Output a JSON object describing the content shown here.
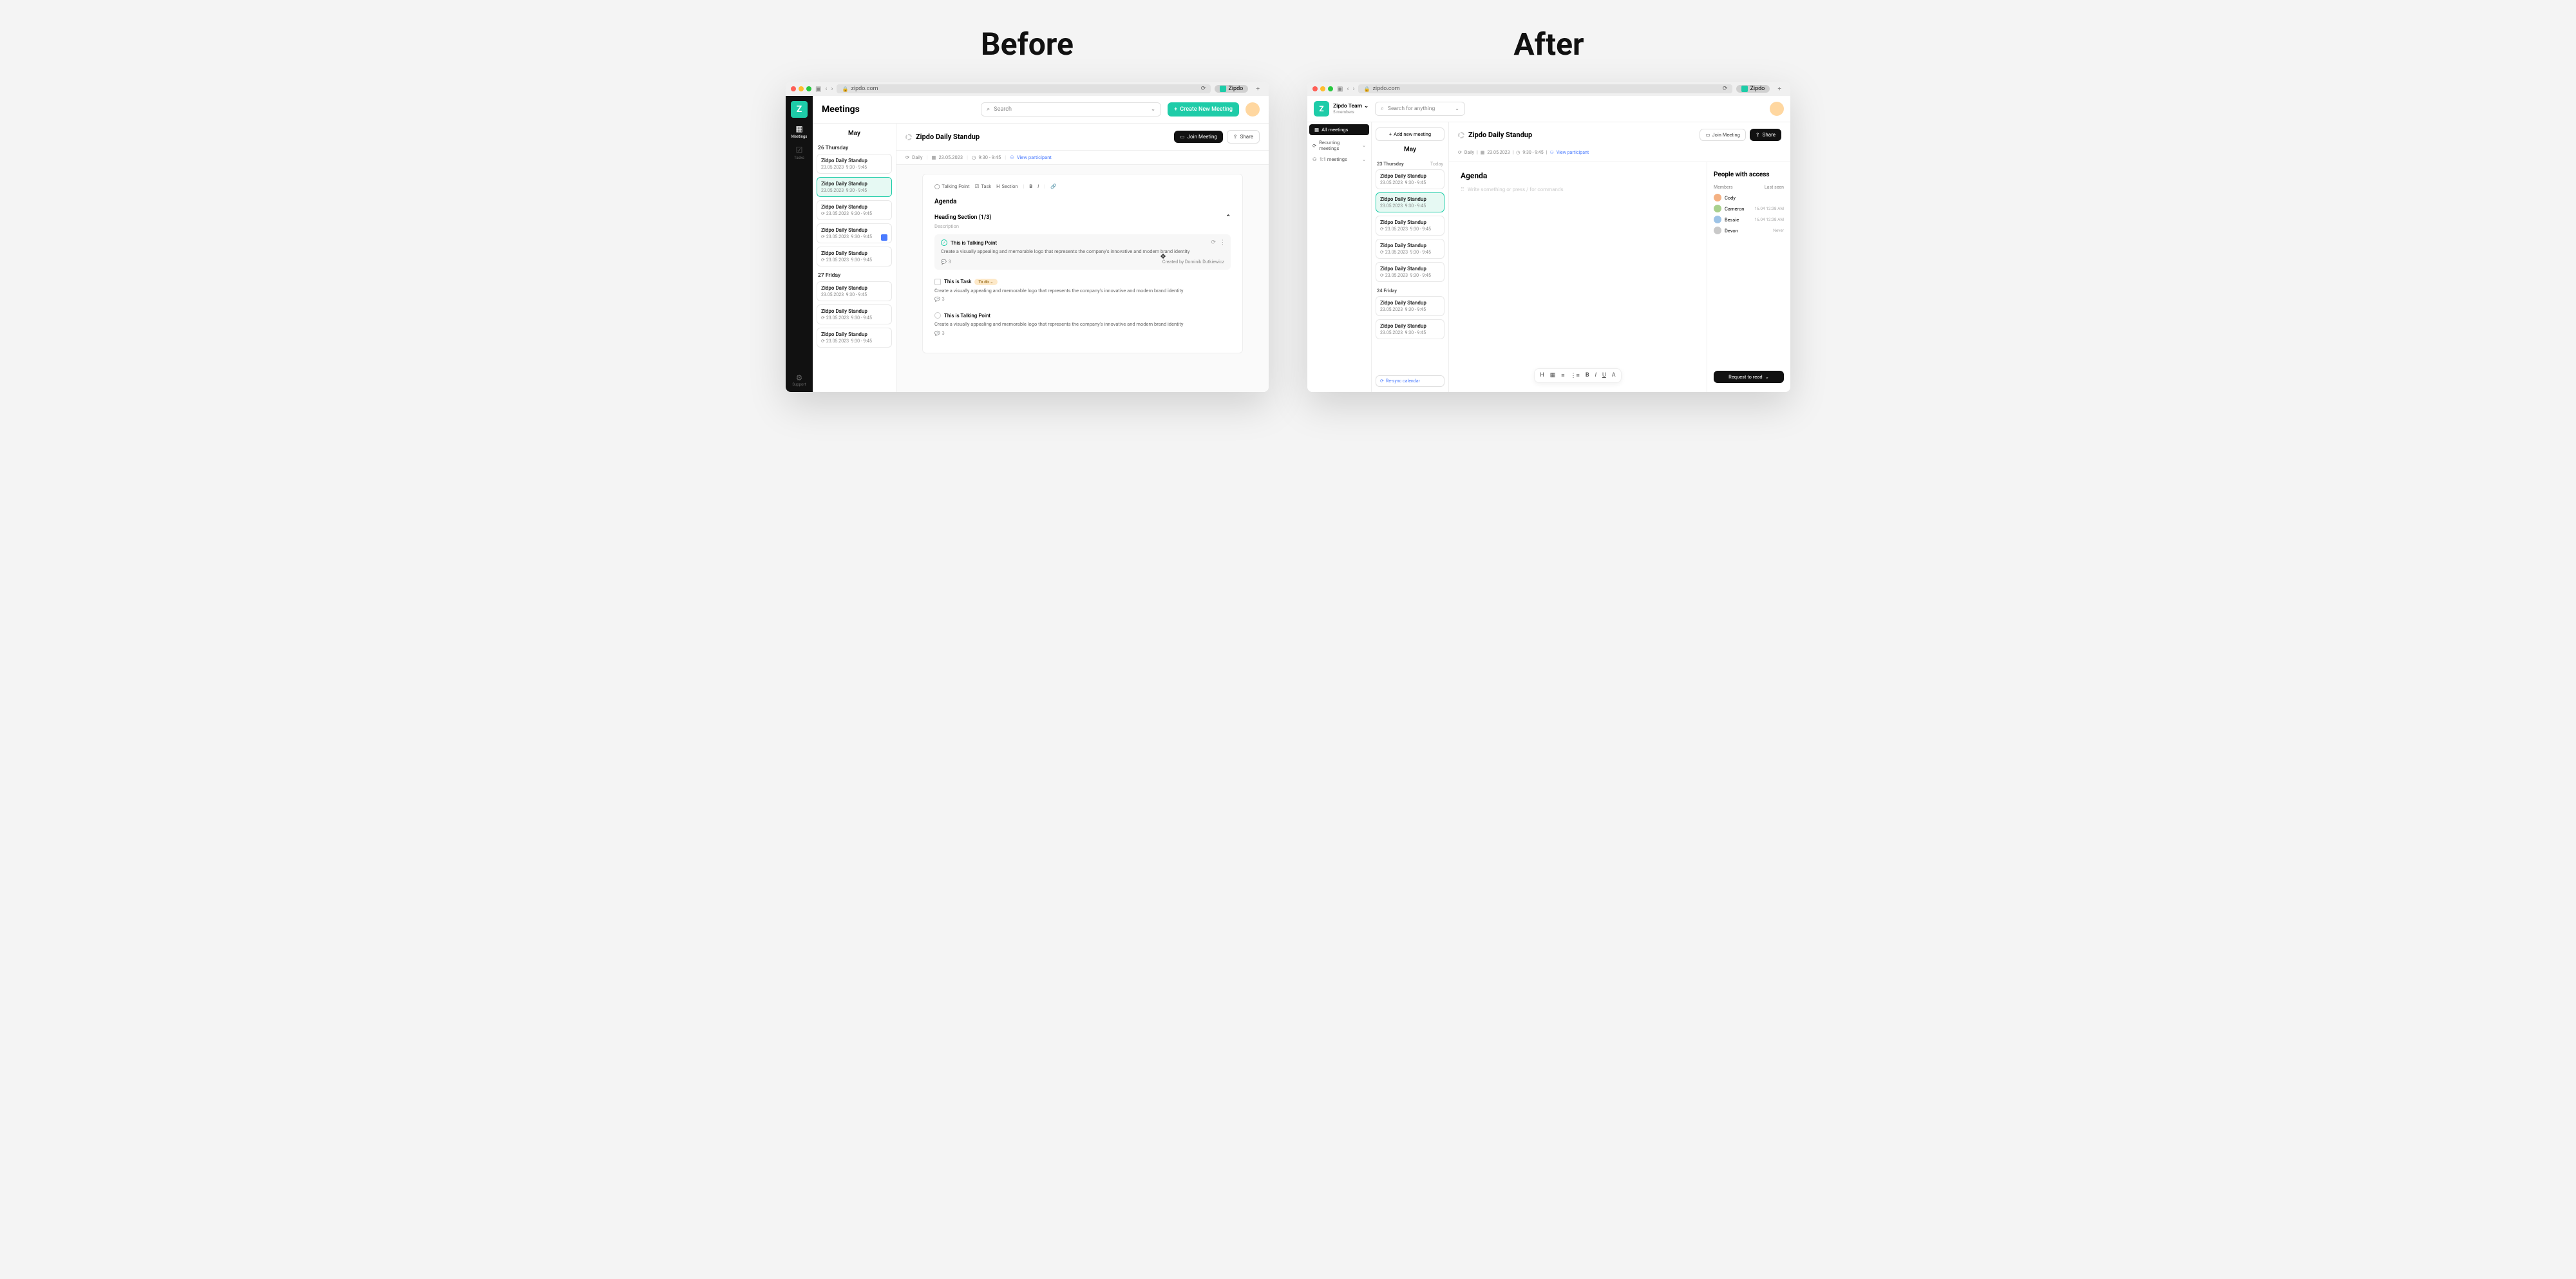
{
  "labels": {
    "before": "Before",
    "after": "After"
  },
  "chrome": {
    "url": "zipdo.com",
    "badge": "Zipdo"
  },
  "before": {
    "header": {
      "title": "Meetings",
      "search_placeholder": "Search",
      "create_btn": "Create New Meeting"
    },
    "rail": {
      "meetings": "Meetings",
      "tasks": "Tasks",
      "support": "Support"
    },
    "sidebar": {
      "month": "May",
      "days": [
        {
          "header": "26 Thursday",
          "items": [
            {
              "title": "Zidpo Daily Standup",
              "date": "23.05.2023",
              "time": "9:30 - 9:45",
              "recurring": false,
              "active": false
            },
            {
              "title": "Zidpo Daily Standup",
              "date": "23.05.2023",
              "time": "9:30 - 9:45",
              "recurring": false,
              "active": true
            },
            {
              "title": "Zidpo Daily Standup",
              "date": "23.05.2023",
              "time": "9:30 - 9:45",
              "recurring": true,
              "active": false
            },
            {
              "title": "Zidpo Daily Standup",
              "date": "23.05.2023",
              "time": "9:30 - 9:45",
              "recurring": true,
              "cal": true,
              "active": false
            },
            {
              "title": "Zidpo Daily Standup",
              "date": "23.05.2023",
              "time": "9:30 - 9:45",
              "recurring": true,
              "active": false
            }
          ]
        },
        {
          "header": "27 Friday",
          "items": [
            {
              "title": "Zidpo Daily Standup",
              "date": "23.05.2023",
              "time": "9:30 - 9:45",
              "recurring": false,
              "active": false
            },
            {
              "title": "Zidpo Daily Standup",
              "date": "23.05.2023",
              "time": "9:30 - 9:45",
              "recurring": true,
              "active": false
            },
            {
              "title": "Zidpo Daily Standup",
              "date": "23.05.2023",
              "time": "9:30 - 9:45",
              "recurring": true,
              "active": false
            }
          ]
        }
      ]
    },
    "content": {
      "title": "Zipdo Daily Standup",
      "join_btn": "Join Meeting",
      "share_btn": "Share",
      "meta": {
        "recurrence": "Daily",
        "date": "23.05.2023",
        "time": "9:30 - 9:45",
        "view_participant": "View participant"
      },
      "toolbar": {
        "talking_point": "Talking Point",
        "task": "Task",
        "section": "Section"
      },
      "agenda": "Agenda",
      "section": {
        "title": "Heading Section (1/3)",
        "desc": "Description"
      },
      "items": [
        {
          "type": "talking",
          "checked": true,
          "title": "This is Talking Point",
          "body": "Create a visually appealing and memorable logo that represents the company's innovative and modern brand identity",
          "comments": "3",
          "creator": "Created by Dominik Dutkiewicz",
          "highlighted": true
        },
        {
          "type": "task",
          "title": "This is Task",
          "tag": "To do",
          "body": "Create a visually appealing and memorable logo that represents the company's innovative and modern brand identity",
          "comments": "3"
        },
        {
          "type": "talking",
          "checked": false,
          "title": "This is Talking Point",
          "body": "Create a visually appealing and memorable logo that represents the company's innovative and modern brand identity",
          "comments": "3"
        }
      ]
    }
  },
  "after": {
    "header": {
      "team": "Zipdo Team",
      "members": "5 members",
      "search_placeholder": "Search for anything"
    },
    "sidebar": {
      "all": "All meetings",
      "recurring": "Recurring meetings",
      "one_on_one": "1:1 meetings"
    },
    "meetlist": {
      "add_btn": "Add new meeting",
      "month": "May",
      "days": [
        {
          "header": "23 Thursday",
          "today": "Today",
          "items": [
            {
              "title": "Zidpo Daily Standup",
              "date": "23.05.2023",
              "time": "9:30 - 9:45",
              "active": false
            },
            {
              "title": "Zidpo Daily Standup",
              "date": "23.05.2023",
              "time": "9:30 - 9:45",
              "active": true
            },
            {
              "title": "Zidpo Daily Standup",
              "date": "23.05.2023",
              "time": "9:30 - 9:45",
              "recurring": true,
              "active": false
            },
            {
              "title": "Zidpo Daily Standup",
              "date": "23.05.2023",
              "time": "9:30 - 9:45",
              "recurring": true,
              "active": false
            },
            {
              "title": "Zidpo Daily Standup",
              "date": "23.05.2023",
              "time": "9:30 - 9:45",
              "recurring": true,
              "active": false
            }
          ]
        },
        {
          "header": "24 Friday",
          "items": [
            {
              "title": "Zidpo Daily Standup",
              "date": "23.05.2023",
              "time": "9:30 - 9:45",
              "active": false
            },
            {
              "title": "Zidpo Daily Standup",
              "date": "23.05.2023",
              "time": "9:30 - 9:45",
              "active": false
            }
          ]
        }
      ],
      "resync": "Re-sync calendar"
    },
    "content": {
      "title": "Zipdo Daily Standup",
      "join_btn": "Join Meeting",
      "share_btn": "Share",
      "meta": {
        "recurrence": "Daily",
        "date": "23.05.2023",
        "time": "9:30 - 9:45",
        "view_participant": "View participant"
      },
      "agenda_title": "Agenda",
      "placeholder": "Write something or press / for commands"
    },
    "people": {
      "title": "People with access",
      "members_label": "Members",
      "last_seen_label": "Last seen",
      "list": [
        {
          "name": "Cody",
          "time": ""
        },
        {
          "name": "Cameron",
          "time": "16.04 12:38 AM"
        },
        {
          "name": "Bessie",
          "time": "16.04 12:38 AM"
        },
        {
          "name": "Devon",
          "time": "Never"
        }
      ],
      "request_btn": "Request to read"
    }
  }
}
